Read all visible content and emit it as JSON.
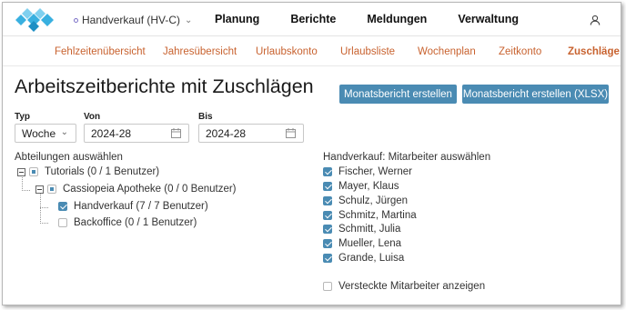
{
  "header": {
    "store": "Handverkauf (HV-C)",
    "menu": [
      "Planung",
      "Berichte",
      "Meldungen",
      "Verwaltung"
    ]
  },
  "subnav": {
    "items": [
      "Fehlzeitenübersicht",
      "Jahresübersicht",
      "Urlaubskonto",
      "Urlaubsliste",
      "Wochenplan",
      "Zeitkonto",
      "Zuschläge"
    ],
    "active": "Zuschläge"
  },
  "page": {
    "title": "Arbeitszeitberichte mit Zuschlägen",
    "btn_monthly": "Monatsbericht erstellen",
    "btn_monthly_xlsx": "Monatsbericht erstellen (XLSX)"
  },
  "filters": {
    "typ_label": "Typ",
    "typ_value": "Woche",
    "von_label": "Von",
    "von_value": "2024-28",
    "bis_label": "Bis",
    "bis_value": "2024-28"
  },
  "departments": {
    "label": "Abteilungen auswählen",
    "tree": [
      {
        "label": "Tutorials (0 / 1 Benutzer)",
        "state": "partial"
      },
      {
        "label": "Cassiopeia Apotheke (0 / 0 Benutzer)",
        "state": "partial"
      },
      {
        "label": "Handverkauf (7 / 7 Benutzer)",
        "state": "checked"
      },
      {
        "label": "Backoffice (0 / 1 Benutzer)",
        "state": "unchecked"
      }
    ]
  },
  "employees": {
    "label": "Handverkauf: Mitarbeiter auswählen",
    "list": [
      "Fischer, Werner",
      "Mayer, Klaus",
      "Schulz, Jürgen",
      "Schmitz, Martina",
      "Schmitt, Julia",
      "Mueller, Lena",
      "Grande, Luisa"
    ],
    "hidden_label": "Versteckte Mitarbeiter anzeigen",
    "hidden_checked": false
  },
  "colors": {
    "accent": "#4a8bb3",
    "subnav": "#c8622f",
    "logo": "#39b0e0"
  }
}
